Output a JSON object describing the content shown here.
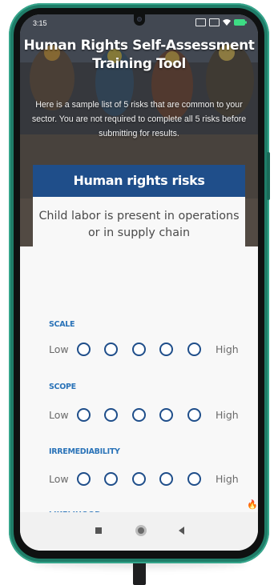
{
  "status_bar": {
    "time": "3:15",
    "icons": [
      "vpn-icon",
      "sim-icon",
      "wifi-icon",
      "battery-icon"
    ]
  },
  "hero": {
    "title": "Human Rights Self-Assessment\nTraining Tool",
    "description": "Here is a sample list of 5 risks that are common to your sector. You are not required to complete all 5 risks before submitting for results."
  },
  "risk_card": {
    "header": "Human rights risks",
    "statement": "Child labor is present in operations or in supply chain"
  },
  "criteria": [
    {
      "label": "SCALE",
      "low": "Low",
      "high": "High",
      "options": 5,
      "selected": null
    },
    {
      "label": "SCOPE",
      "low": "Low",
      "high": "High",
      "options": 5,
      "selected": null
    },
    {
      "label": "IRREMEDIABILITY",
      "low": "Low",
      "high": "High",
      "options": 5,
      "selected": null
    }
  ],
  "next_criterion_peek": "LIKELIHOOD",
  "colors": {
    "header_blue": "#1f4e8a",
    "label_blue": "#2a73b8",
    "phone_green": "#1f7d68",
    "flame": "#e8622c"
  },
  "nav": [
    "recent-apps-button",
    "home-button",
    "back-button"
  ]
}
